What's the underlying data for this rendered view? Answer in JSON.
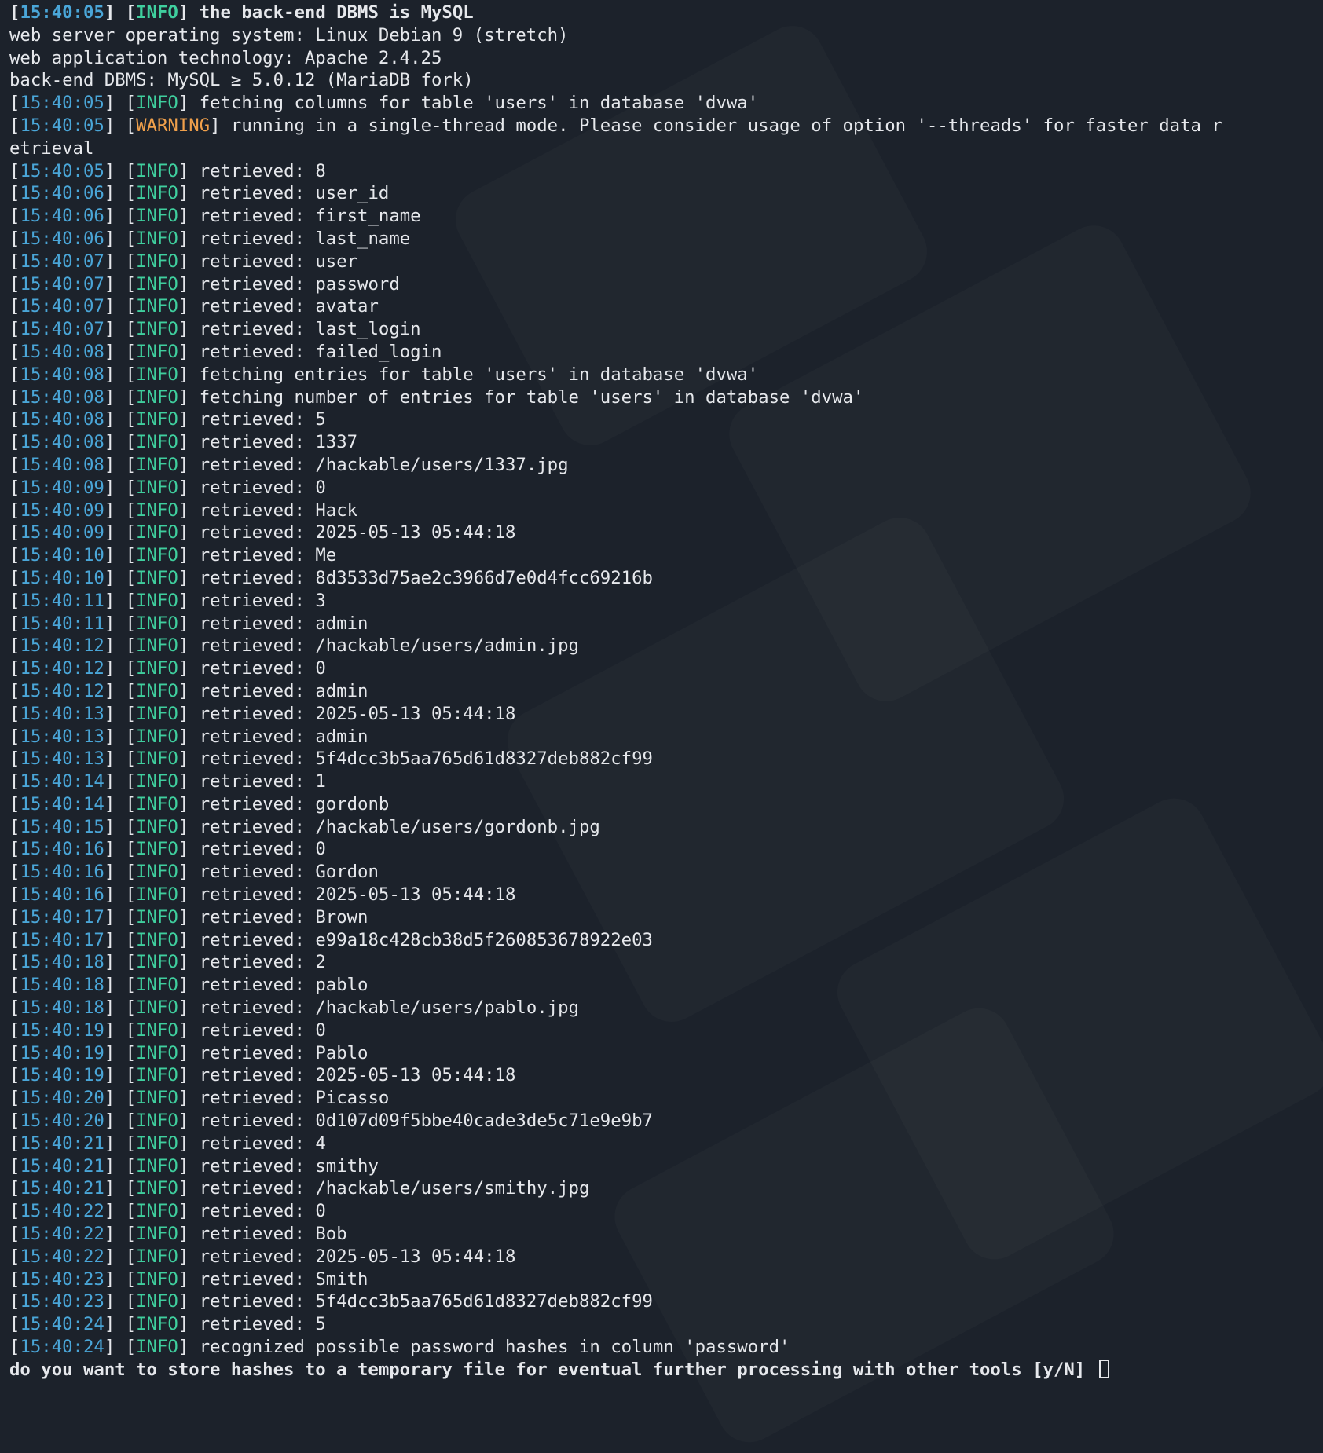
{
  "colors": {
    "background": "#1c222b",
    "text": "#e6e8ec",
    "timestamp": "#4aa6d8",
    "info": "#3fcf9e",
    "warning": "#f0a04b"
  },
  "lines": [
    {
      "kind": "log",
      "ts": "15:40:05",
      "level": "INFO",
      "msg": "the back-end DBMS is MySQL",
      "bold": true
    },
    {
      "kind": "plain",
      "text": "web server operating system: Linux Debian 9 (stretch)"
    },
    {
      "kind": "plain",
      "text": "web application technology: Apache 2.4.25"
    },
    {
      "kind": "plain",
      "text": "back-end DBMS: MySQL ≥ 5.0.12 (MariaDB fork)"
    },
    {
      "kind": "log",
      "ts": "15:40:05",
      "level": "INFO",
      "msg": "fetching columns for table 'users' in database 'dvwa'"
    },
    {
      "kind": "log",
      "ts": "15:40:05",
      "level": "WARNING",
      "msg": "running in a single-thread mode. Please consider usage of option '--threads' for faster data r"
    },
    {
      "kind": "plain",
      "text": "etrieval"
    },
    {
      "kind": "log",
      "ts": "15:40:05",
      "level": "INFO",
      "msg": "retrieved: 8"
    },
    {
      "kind": "log",
      "ts": "15:40:06",
      "level": "INFO",
      "msg": "retrieved: user_id"
    },
    {
      "kind": "log",
      "ts": "15:40:06",
      "level": "INFO",
      "msg": "retrieved: first_name"
    },
    {
      "kind": "log",
      "ts": "15:40:06",
      "level": "INFO",
      "msg": "retrieved: last_name"
    },
    {
      "kind": "log",
      "ts": "15:40:07",
      "level": "INFO",
      "msg": "retrieved: user"
    },
    {
      "kind": "log",
      "ts": "15:40:07",
      "level": "INFO",
      "msg": "retrieved: password"
    },
    {
      "kind": "log",
      "ts": "15:40:07",
      "level": "INFO",
      "msg": "retrieved: avatar"
    },
    {
      "kind": "log",
      "ts": "15:40:07",
      "level": "INFO",
      "msg": "retrieved: last_login"
    },
    {
      "kind": "log",
      "ts": "15:40:08",
      "level": "INFO",
      "msg": "retrieved: failed_login"
    },
    {
      "kind": "log",
      "ts": "15:40:08",
      "level": "INFO",
      "msg": "fetching entries for table 'users' in database 'dvwa'"
    },
    {
      "kind": "log",
      "ts": "15:40:08",
      "level": "INFO",
      "msg": "fetching number of entries for table 'users' in database 'dvwa'"
    },
    {
      "kind": "log",
      "ts": "15:40:08",
      "level": "INFO",
      "msg": "retrieved: 5"
    },
    {
      "kind": "log",
      "ts": "15:40:08",
      "level": "INFO",
      "msg": "retrieved: 1337"
    },
    {
      "kind": "log",
      "ts": "15:40:08",
      "level": "INFO",
      "msg": "retrieved: /hackable/users/1337.jpg"
    },
    {
      "kind": "log",
      "ts": "15:40:09",
      "level": "INFO",
      "msg": "retrieved: 0"
    },
    {
      "kind": "log",
      "ts": "15:40:09",
      "level": "INFO",
      "msg": "retrieved: Hack"
    },
    {
      "kind": "log",
      "ts": "15:40:09",
      "level": "INFO",
      "msg": "retrieved: 2025-05-13 05:44:18"
    },
    {
      "kind": "log",
      "ts": "15:40:10",
      "level": "INFO",
      "msg": "retrieved: Me"
    },
    {
      "kind": "log",
      "ts": "15:40:10",
      "level": "INFO",
      "msg": "retrieved: 8d3533d75ae2c3966d7e0d4fcc69216b"
    },
    {
      "kind": "log",
      "ts": "15:40:11",
      "level": "INFO",
      "msg": "retrieved: 3"
    },
    {
      "kind": "log",
      "ts": "15:40:11",
      "level": "INFO",
      "msg": "retrieved: admin"
    },
    {
      "kind": "log",
      "ts": "15:40:12",
      "level": "INFO",
      "msg": "retrieved: /hackable/users/admin.jpg"
    },
    {
      "kind": "log",
      "ts": "15:40:12",
      "level": "INFO",
      "msg": "retrieved: 0"
    },
    {
      "kind": "log",
      "ts": "15:40:12",
      "level": "INFO",
      "msg": "retrieved: admin"
    },
    {
      "kind": "log",
      "ts": "15:40:13",
      "level": "INFO",
      "msg": "retrieved: 2025-05-13 05:44:18"
    },
    {
      "kind": "log",
      "ts": "15:40:13",
      "level": "INFO",
      "msg": "retrieved: admin"
    },
    {
      "kind": "log",
      "ts": "15:40:13",
      "level": "INFO",
      "msg": "retrieved: 5f4dcc3b5aa765d61d8327deb882cf99"
    },
    {
      "kind": "log",
      "ts": "15:40:14",
      "level": "INFO",
      "msg": "retrieved: 1"
    },
    {
      "kind": "log",
      "ts": "15:40:14",
      "level": "INFO",
      "msg": "retrieved: gordonb"
    },
    {
      "kind": "log",
      "ts": "15:40:15",
      "level": "INFO",
      "msg": "retrieved: /hackable/users/gordonb.jpg"
    },
    {
      "kind": "log",
      "ts": "15:40:16",
      "level": "INFO",
      "msg": "retrieved: 0"
    },
    {
      "kind": "log",
      "ts": "15:40:16",
      "level": "INFO",
      "msg": "retrieved: Gordon"
    },
    {
      "kind": "log",
      "ts": "15:40:16",
      "level": "INFO",
      "msg": "retrieved: 2025-05-13 05:44:18"
    },
    {
      "kind": "log",
      "ts": "15:40:17",
      "level": "INFO",
      "msg": "retrieved: Brown"
    },
    {
      "kind": "log",
      "ts": "15:40:17",
      "level": "INFO",
      "msg": "retrieved: e99a18c428cb38d5f260853678922e03"
    },
    {
      "kind": "log",
      "ts": "15:40:18",
      "level": "INFO",
      "msg": "retrieved: 2"
    },
    {
      "kind": "log",
      "ts": "15:40:18",
      "level": "INFO",
      "msg": "retrieved: pablo"
    },
    {
      "kind": "log",
      "ts": "15:40:18",
      "level": "INFO",
      "msg": "retrieved: /hackable/users/pablo.jpg"
    },
    {
      "kind": "log",
      "ts": "15:40:19",
      "level": "INFO",
      "msg": "retrieved: 0"
    },
    {
      "kind": "log",
      "ts": "15:40:19",
      "level": "INFO",
      "msg": "retrieved: Pablo"
    },
    {
      "kind": "log",
      "ts": "15:40:19",
      "level": "INFO",
      "msg": "retrieved: 2025-05-13 05:44:18"
    },
    {
      "kind": "log",
      "ts": "15:40:20",
      "level": "INFO",
      "msg": "retrieved: Picasso"
    },
    {
      "kind": "log",
      "ts": "15:40:20",
      "level": "INFO",
      "msg": "retrieved: 0d107d09f5bbe40cade3de5c71e9e9b7"
    },
    {
      "kind": "log",
      "ts": "15:40:21",
      "level": "INFO",
      "msg": "retrieved: 4"
    },
    {
      "kind": "log",
      "ts": "15:40:21",
      "level": "INFO",
      "msg": "retrieved: smithy"
    },
    {
      "kind": "log",
      "ts": "15:40:21",
      "level": "INFO",
      "msg": "retrieved: /hackable/users/smithy.jpg"
    },
    {
      "kind": "log",
      "ts": "15:40:22",
      "level": "INFO",
      "msg": "retrieved: 0"
    },
    {
      "kind": "log",
      "ts": "15:40:22",
      "level": "INFO",
      "msg": "retrieved: Bob"
    },
    {
      "kind": "log",
      "ts": "15:40:22",
      "level": "INFO",
      "msg": "retrieved: 2025-05-13 05:44:18"
    },
    {
      "kind": "log",
      "ts": "15:40:23",
      "level": "INFO",
      "msg": "retrieved: Smith"
    },
    {
      "kind": "log",
      "ts": "15:40:23",
      "level": "INFO",
      "msg": "retrieved: 5f4dcc3b5aa765d61d8327deb882cf99"
    },
    {
      "kind": "log",
      "ts": "15:40:24",
      "level": "INFO",
      "msg": "retrieved: 5"
    },
    {
      "kind": "log",
      "ts": "15:40:24",
      "level": "INFO",
      "msg": "recognized possible password hashes in column 'password'"
    }
  ],
  "prompt": {
    "text": "do you want to store hashes to a temporary file for eventual further processing with other tools [y/N] "
  }
}
